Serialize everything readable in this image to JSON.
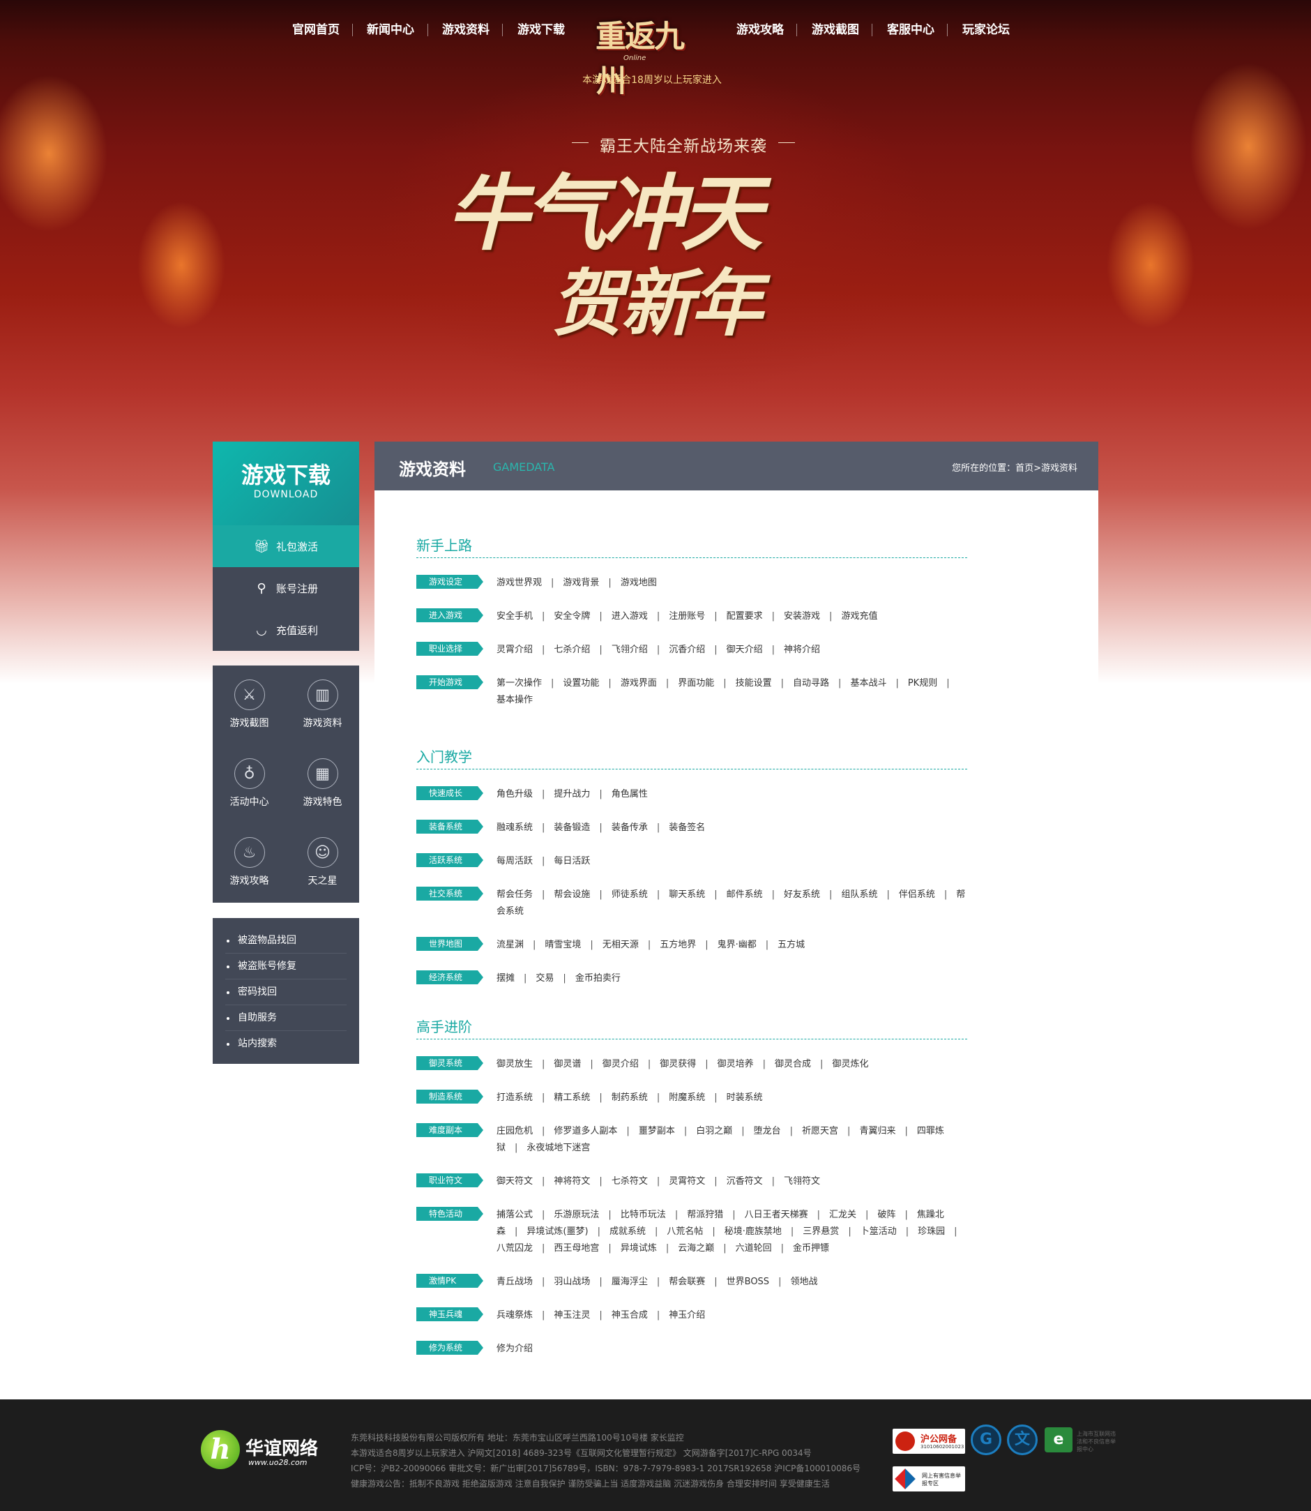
{
  "nav": {
    "items": [
      "官网首页",
      "新闻中心",
      "游戏资料",
      "游戏下载",
      "游戏攻略",
      "游戏截图",
      "客服中心",
      "玩家论坛"
    ]
  },
  "logo": {
    "title": "重返九州",
    "sub": "Online"
  },
  "age_notice": "本游戏适合18周岁以上玩家进入",
  "hero": {
    "subtitle": "霸王大陆全新战场来袭",
    "line1": "牛气冲天",
    "line2": "贺新年"
  },
  "sidebar": {
    "download_title": "游戏下载",
    "download_sub": "DOWNLOAD",
    "download_items": [
      {
        "label": "礼包激活",
        "icon": "gift-icon"
      },
      {
        "label": "账号注册",
        "icon": "user-icon"
      },
      {
        "label": "充值返利",
        "icon": "bowl-icon"
      }
    ],
    "icon_links": [
      {
        "label": "游戏截图",
        "icon": "sword-icon",
        "glyph": "⚔"
      },
      {
        "label": "游戏资料",
        "icon": "book-icon",
        "glyph": "▥"
      },
      {
        "label": "活动中心",
        "icon": "gourd-icon",
        "glyph": "♁"
      },
      {
        "label": "游戏特色",
        "icon": "grid-icon",
        "glyph": "▦"
      },
      {
        "label": "游戏攻略",
        "icon": "pot-icon",
        "glyph": "♨"
      },
      {
        "label": "天之星",
        "icon": "mask-icon",
        "glyph": "☺"
      }
    ],
    "service_links": [
      "被盗物品找回",
      "被盗账号修复",
      "密码找回",
      "自助服务",
      "站内搜索"
    ]
  },
  "main": {
    "title": "游戏资料",
    "title_en": "GAMEDATA",
    "crumb": "您所在的位置：首页>游戏资料",
    "sections": [
      {
        "title": "新手上路",
        "cats": [
          {
            "tag": "游戏设定",
            "links": [
              "游戏世界观",
              "游戏背景",
              "游戏地图"
            ]
          },
          {
            "tag": "进入游戏",
            "links": [
              "安全手机",
              "安全令牌",
              "进入游戏",
              "注册账号",
              "配置要求",
              "安装游戏",
              "游戏充值"
            ]
          },
          {
            "tag": "职业选择",
            "links": [
              "灵霄介绍",
              "七杀介绍",
              "飞翎介绍",
              "沉香介绍",
              "御天介绍",
              "神将介绍"
            ]
          },
          {
            "tag": "开始游戏",
            "links": [
              "第一次操作",
              "设置功能",
              "游戏界面",
              "界面功能",
              "技能设置",
              "自动寻路",
              "基本战斗",
              "PK规则",
              "基本操作"
            ]
          }
        ]
      },
      {
        "title": "入门教学",
        "cats": [
          {
            "tag": "快速成长",
            "links": [
              "角色升级",
              "提升战力",
              "角色属性"
            ]
          },
          {
            "tag": "装备系统",
            "links": [
              "融魂系统",
              "装备锻造",
              "装备传承",
              "装备签名"
            ]
          },
          {
            "tag": "活跃系统",
            "links": [
              "每周活跃",
              "每日活跃"
            ]
          },
          {
            "tag": "社交系统",
            "links": [
              "帮会任务",
              "帮会设施",
              "师徒系统",
              "聊天系统",
              "邮件系统",
              "好友系统",
              "组队系统",
              "伴侣系统",
              "帮会系统"
            ]
          },
          {
            "tag": "世界地图",
            "links": [
              "流星渊",
              "晴雪宝境",
              "无相天源",
              "五方地界",
              "鬼界·幽都",
              "五方城"
            ]
          },
          {
            "tag": "经济系统",
            "links": [
              "摆摊",
              "交易",
              "金币拍卖行"
            ]
          }
        ]
      },
      {
        "title": "高手进阶",
        "cats": [
          {
            "tag": "御灵系统",
            "links": [
              "御灵放生",
              "御灵谱",
              "御灵介绍",
              "御灵获得",
              "御灵培养",
              "御灵合成",
              "御灵炼化"
            ]
          },
          {
            "tag": "制造系统",
            "links": [
              "打造系统",
              "精工系统",
              "制药系统",
              "附魔系统",
              "时装系统"
            ]
          },
          {
            "tag": "难度副本",
            "links": [
              "庄园危机",
              "修罗道多人副本",
              "噩梦副本",
              "白羽之巅",
              "堕龙台",
              "祈愿天宫",
              "青翼归来",
              "四罪炼狱",
              "永夜城地下迷宫"
            ]
          },
          {
            "tag": "职业符文",
            "links": [
              "御天符文",
              "神将符文",
              "七杀符文",
              "灵霄符文",
              "沉香符文",
              "飞翎符文"
            ]
          },
          {
            "tag": "特色活动",
            "links": [
              "捕落公式",
              "乐游原玩法",
              "比特币玩法",
              "帮派狩猎",
              "八日王者天梯赛",
              "汇龙关",
              "破阵",
              "焦躁北森",
              "异境试炼(噩梦)",
              "成就系统",
              "八荒名帖",
              "秘境·鹿族禁地",
              "三界悬赏",
              "卜筮活动",
              "珍珠园",
              "八荒囚龙",
              "西王母地宫",
              "异境试炼",
              "云海之巅",
              "六道轮回",
              "金币押镖"
            ]
          },
          {
            "tag": "激情PK",
            "links": [
              "青丘战场",
              "羽山战场",
              "蜃海浮尘",
              "帮会联赛",
              "世界BOSS",
              "领地战"
            ]
          },
          {
            "tag": "神玉兵魂",
            "links": [
              "兵魂祭炼",
              "神玉注灵",
              "神玉合成",
              "神玉介绍"
            ]
          },
          {
            "tag": "修为系统",
            "links": [
              "修为介绍"
            ]
          }
        ]
      }
    ]
  },
  "footer": {
    "brand": "华谊网络",
    "brand_url": "www.uo28.com",
    "lines": [
      "东莞科技科技股份有限公司版权所有    地址：东莞市宝山区呼兰西路100号10号楼    家长监控",
      "本游戏适合8周岁以上玩家进入 沪网文[2018] 4689-323号《互联网文化管理暂行规定》 文网游备字[2017]C-RPG 0034号",
      "ICP号：沪B2-20090066 审批文号：新广出审[2017]56789号，ISBN：978-7-7979-8983-1 2017SR192658 沪ICP备100010086号",
      "健康游戏公告：抵制不良游戏 拒绝盗版游戏 注意自我保护 谨防受骗上当 适度游戏益脑 沉迷游戏伤身 合理安排时间 享受健康生活"
    ],
    "badge1_title": "沪公网备",
    "badge1_num": "31010602001023",
    "badge2_text": "网上有害信息举报专区",
    "gov_text": "上海市互联网违法和不良信息举报中心"
  },
  "colors": {
    "accent": "#1aa9a3",
    "panel": "#424856",
    "header": "#565c6b",
    "footer": "#1d1d1d"
  }
}
